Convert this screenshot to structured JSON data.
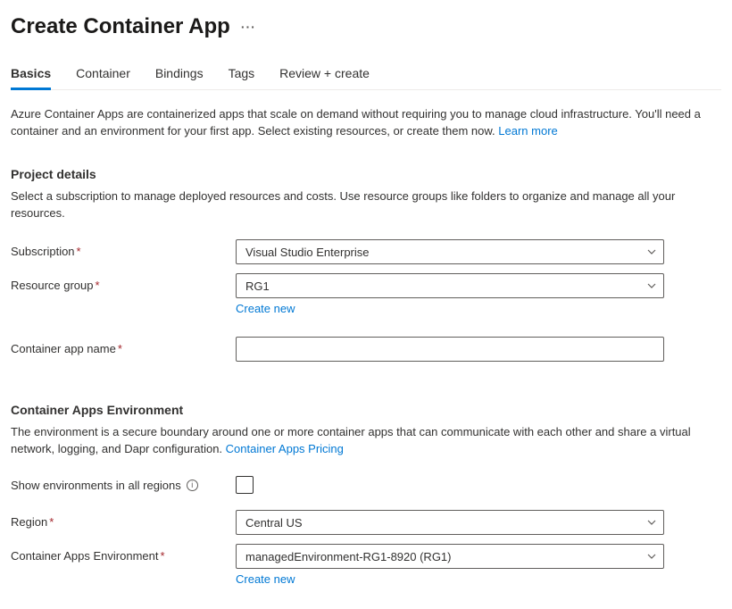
{
  "header": {
    "title": "Create Container App"
  },
  "tabs": [
    {
      "label": "Basics",
      "active": true
    },
    {
      "label": "Container",
      "active": false
    },
    {
      "label": "Bindings",
      "active": false
    },
    {
      "label": "Tags",
      "active": false
    },
    {
      "label": "Review + create",
      "active": false
    }
  ],
  "intro": {
    "text": "Azure Container Apps are containerized apps that scale on demand without requiring you to manage cloud infrastructure. You'll need a container and an environment for your first app. Select existing resources, or create them now. ",
    "link": "Learn more"
  },
  "project": {
    "heading": "Project details",
    "desc": "Select a subscription to manage deployed resources and costs. Use resource groups like folders to organize and manage all your resources.",
    "subscription_label": "Subscription",
    "subscription_value": "Visual Studio Enterprise",
    "resource_group_label": "Resource group",
    "resource_group_value": "RG1",
    "create_new": "Create new",
    "container_app_name_label": "Container app name",
    "container_app_name_value": ""
  },
  "env": {
    "heading": "Container Apps Environment",
    "desc_pre": "The environment is a secure boundary around one or more container apps that can communicate with each other and share a virtual network, logging, and Dapr configuration. ",
    "desc_link": "Container Apps Pricing",
    "show_all_label": "Show environments in all regions",
    "show_all_checked": false,
    "region_label": "Region",
    "region_value": "Central US",
    "env_label": "Container Apps Environment",
    "env_value": "managedEnvironment-RG1-8920 (RG1)",
    "create_new": "Create new"
  }
}
